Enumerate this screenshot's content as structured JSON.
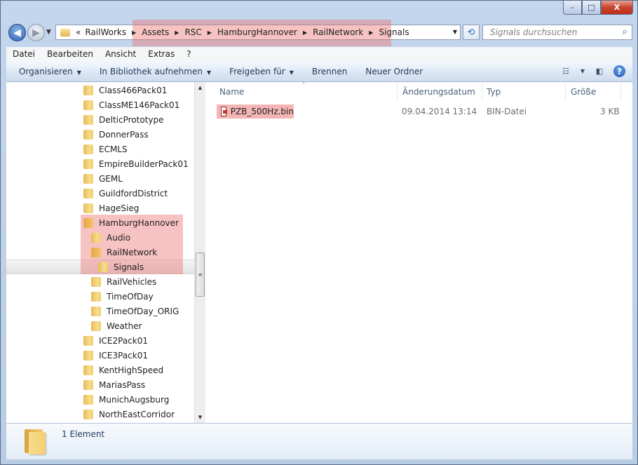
{
  "window": {
    "buttons": {
      "minimize": "–",
      "maximize": "□",
      "close": "X"
    }
  },
  "address": {
    "prefix": "«",
    "crumbs": [
      "RailWorks",
      "Assets",
      "RSC",
      "HamburgHannover",
      "RailNetwork",
      "Signals"
    ],
    "search_placeholder": "Signals durchsuchen"
  },
  "menu": [
    "Datei",
    "Bearbeiten",
    "Ansicht",
    "Extras",
    "?"
  ],
  "toolbar": {
    "organize": "Organisieren",
    "library": "In Bibliothek aufnehmen",
    "share": "Freigeben für",
    "burn": "Brennen",
    "new_folder": "Neuer Ordner"
  },
  "tree": [
    {
      "label": "Class466Pack01",
      "level": 1
    },
    {
      "label": "ClassME146Pack01",
      "level": 1
    },
    {
      "label": "DelticPrototype",
      "level": 1
    },
    {
      "label": "DonnerPass",
      "level": 1
    },
    {
      "label": "ECMLS",
      "level": 1
    },
    {
      "label": "EmpireBuilderPack01",
      "level": 1
    },
    {
      "label": "GEML",
      "level": 1
    },
    {
      "label": "GuildfordDistrict",
      "level": 1
    },
    {
      "label": "HageSieg",
      "level": 1
    },
    {
      "label": "HamburgHannover",
      "level": 1,
      "open": true
    },
    {
      "label": "Audio",
      "level": 2
    },
    {
      "label": "RailNetwork",
      "level": 2,
      "open": true
    },
    {
      "label": "Signals",
      "level": 3,
      "selected": true
    },
    {
      "label": "RailVehicles",
      "level": 2
    },
    {
      "label": "TimeOfDay",
      "level": 2
    },
    {
      "label": "TimeOfDay_ORIG",
      "level": 2
    },
    {
      "label": "Weather",
      "level": 2
    },
    {
      "label": "ICE2Pack01",
      "level": 1
    },
    {
      "label": "ICE3Pack01",
      "level": 1
    },
    {
      "label": "KentHighSpeed",
      "level": 1
    },
    {
      "label": "MariasPass",
      "level": 1
    },
    {
      "label": "MunichAugsburg",
      "level": 1
    },
    {
      "label": "NorthEastCorridor",
      "level": 1
    }
  ],
  "columns": [
    "Name",
    "Änderungsdatum",
    "Typ",
    "Größe"
  ],
  "files": [
    {
      "name": "PZB_500Hz.bin",
      "modified": "09.04.2014 13:14",
      "type": "BIN-Datei",
      "size": "3 KB"
    }
  ],
  "status": {
    "count": "1 Element"
  },
  "colors": {
    "highlight": "#eb7878",
    "titlebar": "#c4d6ee",
    "close": "#c8442e"
  }
}
